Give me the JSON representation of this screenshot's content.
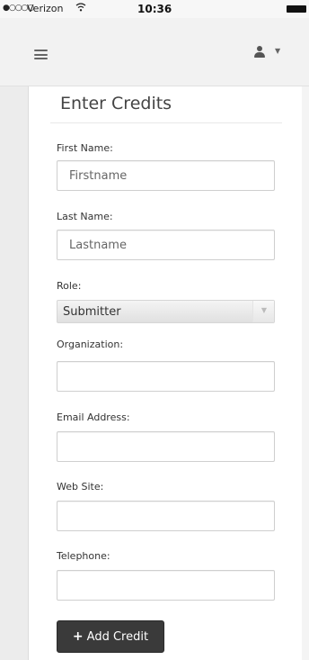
{
  "status_bar": {
    "signal": "●○○○○",
    "carrier": "Verizon",
    "time": "10:36"
  },
  "page": {
    "title": "Enter Credits"
  },
  "form": {
    "first_name": {
      "label": "First Name:",
      "placeholder": "Firstname",
      "value": ""
    },
    "last_name": {
      "label": "Last Name:",
      "placeholder": "Lastname",
      "value": ""
    },
    "role": {
      "label": "Role:",
      "selected": "Submitter"
    },
    "organization": {
      "label": "Organization:",
      "value": ""
    },
    "email": {
      "label": "Email Address:",
      "value": ""
    },
    "website": {
      "label": "Web Site:",
      "value": ""
    },
    "telephone": {
      "label": "Telephone:",
      "value": ""
    }
  },
  "actions": {
    "add_credit_label": "Add Credit"
  },
  "icons": {
    "menu": "hamburger-icon",
    "user": "user-icon",
    "add": "plus-icon"
  },
  "colors": {
    "navbar_bg": "#f2f2f2",
    "button_bg": "#3a3a3a",
    "button_text": "#ffffff"
  }
}
